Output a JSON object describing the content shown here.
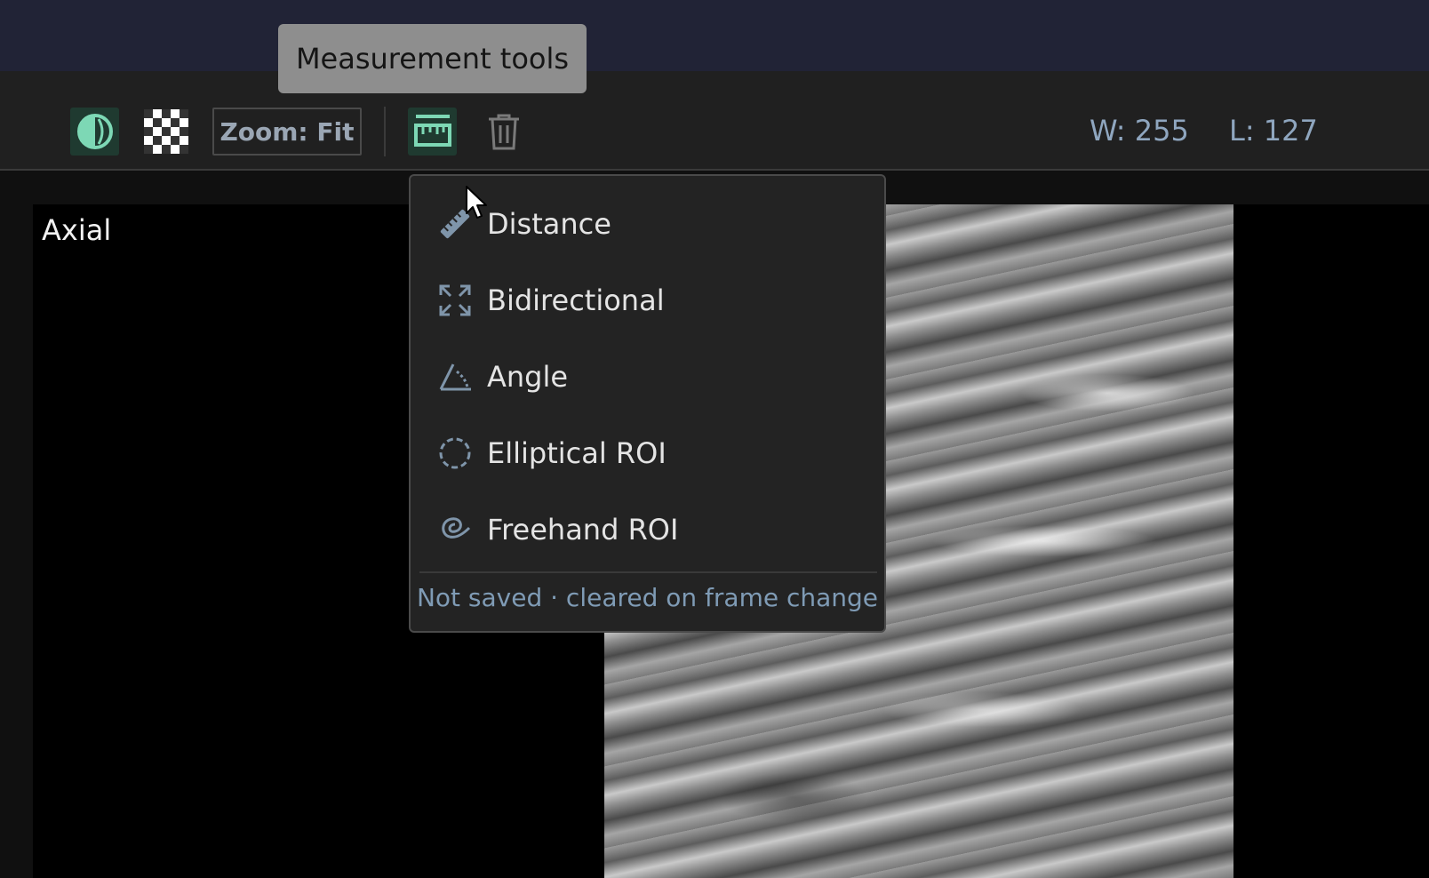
{
  "tooltip": "Measurement tools",
  "toolbar": {
    "zoom_label": "Zoom: Fit",
    "window": "W: 255",
    "level": "L: 127",
    "accent_color": "#7dd8b5"
  },
  "viewport": {
    "label": "Axial"
  },
  "menu": {
    "items": [
      {
        "label": "Distance",
        "icon": "ruler-icon"
      },
      {
        "label": "Bidirectional",
        "icon": "bidirectional-arrows-icon"
      },
      {
        "label": "Angle",
        "icon": "angle-icon"
      },
      {
        "label": "Elliptical ROI",
        "icon": "dashed-circle-icon"
      },
      {
        "label": "Freehand ROI",
        "icon": "freehand-loop-icon"
      }
    ],
    "footer": "Not saved · cleared on frame change"
  }
}
